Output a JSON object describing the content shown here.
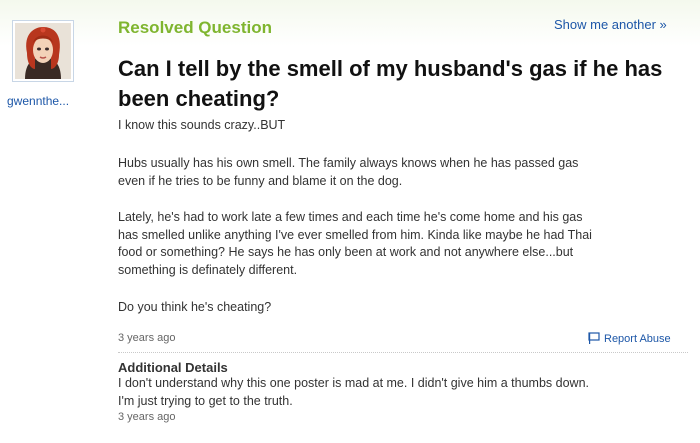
{
  "asker": {
    "username": "gwennthe..."
  },
  "header": {
    "status_label": "Resolved Question",
    "show_another": "Show me another »"
  },
  "question": {
    "title": "Can I tell by the smell of my husband's gas if he has been cheating?",
    "paragraphs": [
      "I know this sounds crazy..BUT",
      "Hubs usually has his own smell. The family always knows when he has passed gas\neven if he tries to be funny and blame it on the dog.",
      "Lately, he's had to work late a few times and each time he's come home and his gas\nhas smelled unlike anything I've ever smelled from him. Kinda like maybe he had Thai\nfood or something? He says he has only been at work and not anywhere else...but\nsomething is definately different.",
      "Do you think he's cheating?"
    ],
    "posted": "3 years ago",
    "report_abuse": "Report Abuse"
  },
  "additional_details": {
    "heading": "Additional Details",
    "text": "I don't understand why this one poster is mad at me. I didn't give him a thumbs down.\nI'm just trying to get to the truth.",
    "posted": "3 years ago"
  },
  "colors": {
    "resolved_green": "#7fb52f",
    "link_blue": "#1d57a8",
    "title_black": "#111111"
  },
  "icons": {
    "avatar": "avatar-icon",
    "report": "flag-icon"
  }
}
